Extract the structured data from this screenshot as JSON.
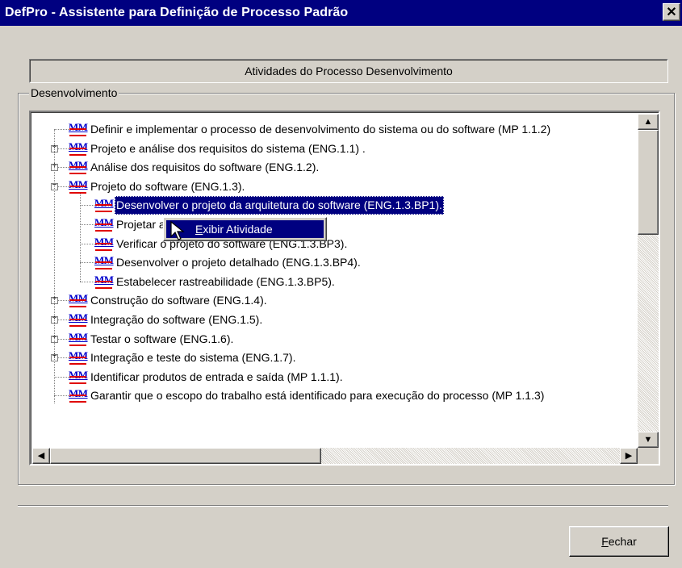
{
  "window": {
    "title": "DefPro - Assistente para Definição de Processo Padrão",
    "close_glyph": "✕"
  },
  "header_panel": {
    "text": "Atividades do Processo Desenvolvimento"
  },
  "group": {
    "label": "Desenvolvimento"
  },
  "tree": {
    "icon_text": "MM",
    "items": [
      {
        "label": "Definir e implementar o processo de desenvolvimento do sistema ou do software (MP 1.1.2)",
        "level": 0,
        "expander": ""
      },
      {
        "label": "Projeto e análise dos requisitos do sistema (ENG.1.1) .",
        "level": 0,
        "expander": "+"
      },
      {
        "label": "Análise dos requisitos do software (ENG.1.2).",
        "level": 0,
        "expander": "+"
      },
      {
        "label": "Projeto do software (ENG.1.3).",
        "level": 0,
        "expander": "−"
      },
      {
        "label": "Desenvolver o projeto da arquitetura do software (ENG.1.3.BP1).",
        "level": 1,
        "expander": "",
        "selected": true
      },
      {
        "label": "Projetar as interfaces (ENG.1.3.BP2).",
        "level": 1,
        "expander": ""
      },
      {
        "label": "Verificar o projeto do software (ENG.1.3.BP3).",
        "level": 1,
        "expander": ""
      },
      {
        "label": "Desenvolver o projeto detalhado (ENG.1.3.BP4).",
        "level": 1,
        "expander": ""
      },
      {
        "label": "Estabelecer rastreabilidade (ENG.1.3.BP5).",
        "level": 1,
        "expander": ""
      },
      {
        "label": "Construção do software (ENG.1.4).",
        "level": 0,
        "expander": "+"
      },
      {
        "label": "Integração do software (ENG.1.5).",
        "level": 0,
        "expander": "+"
      },
      {
        "label": "Testar o software (ENG.1.6).",
        "level": 0,
        "expander": "+"
      },
      {
        "label": "Integração e teste do sistema (ENG.1.7).",
        "level": 0,
        "expander": "+"
      },
      {
        "label": "Identificar produtos de entrada e saída (MP 1.1.1).",
        "level": 0,
        "expander": ""
      },
      {
        "label": "Garantir que o escopo do trabalho está identificado  para execução do processo (MP 1.1.3)",
        "level": 0,
        "expander": ""
      }
    ]
  },
  "context_menu": {
    "item_prefix": "E",
    "item_rest": "xibir Atividade"
  },
  "footer": {
    "close_button_prefix": "F",
    "close_button_rest": "echar"
  }
}
